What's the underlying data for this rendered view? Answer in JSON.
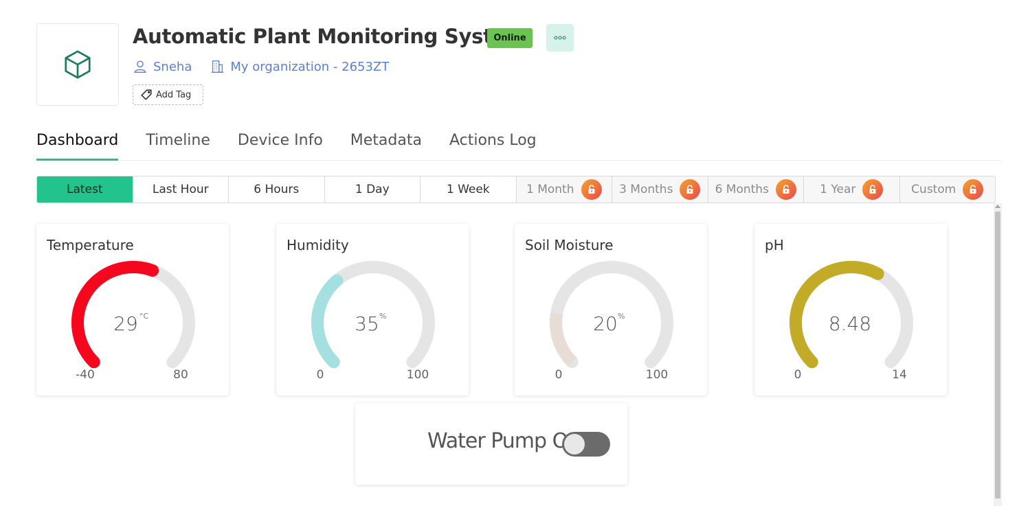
{
  "device": {
    "title": "Automatic Plant Monitoring System",
    "status": "Online",
    "owner": "Sneha",
    "organization": "My organization - 2653ZT",
    "add_tag_label": "Add Tag"
  },
  "tabs": [
    {
      "label": "Dashboard",
      "active": true
    },
    {
      "label": "Timeline"
    },
    {
      "label": "Device Info"
    },
    {
      "label": "Metadata"
    },
    {
      "label": "Actions Log"
    }
  ],
  "time_ranges": [
    {
      "label": "Latest",
      "active": true
    },
    {
      "label": "Last Hour"
    },
    {
      "label": "6 Hours"
    },
    {
      "label": "1 Day"
    },
    {
      "label": "1 Week"
    },
    {
      "label": "1 Month",
      "locked": true
    },
    {
      "label": "3 Months",
      "locked": true
    },
    {
      "label": "6 Months",
      "locked": true
    },
    {
      "label": "1 Year",
      "locked": true
    },
    {
      "label": "Custom",
      "locked": true
    }
  ],
  "gauges": [
    {
      "title": "Temperature",
      "value": "29",
      "unit": "°C",
      "min": "-40",
      "max": "80",
      "color": "#f5071e"
    },
    {
      "title": "Humidity",
      "value": "35",
      "unit": "%",
      "min": "0",
      "max": "100",
      "color": "#a5e0e0"
    },
    {
      "title": "Soil Moisture",
      "value": "20",
      "unit": "%",
      "min": "0",
      "max": "100",
      "color": "#e8dcd7"
    },
    {
      "title": "pH",
      "value": "8.48",
      "unit": "",
      "min": "0",
      "max": "14",
      "color": "#c1ab27"
    }
  ],
  "water_pump": {
    "label": "Water Pump OFF",
    "state": "off"
  },
  "colors": {
    "accent": "#23c38d",
    "link": "#5b7fd3",
    "online": "#6bc44f",
    "track": "#e5e5e5"
  }
}
